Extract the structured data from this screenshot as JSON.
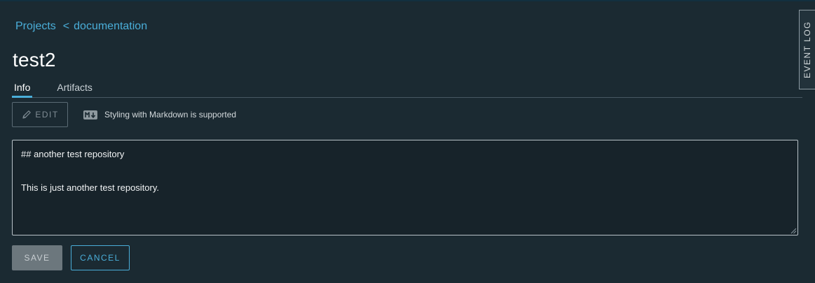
{
  "breadcrumb": {
    "parent": "Projects",
    "separator": "<",
    "current": "documentation"
  },
  "page": {
    "title": "test2"
  },
  "tabs": [
    {
      "label": "Info",
      "active": true
    },
    {
      "label": "Artifacts",
      "active": false
    }
  ],
  "toolbar": {
    "edit_label": "EDIT",
    "edit_icon": "pencil-icon",
    "markdown_icon": "markdown-icon",
    "markdown_hint": "Styling with Markdown is supported"
  },
  "editor": {
    "line1": "## another test repository",
    "line2": "This is just another test repository."
  },
  "actions": {
    "save_label": "SAVE",
    "cancel_label": "CANCEL"
  },
  "side_panel": {
    "event_log_label": "EVENT LOG"
  },
  "colors": {
    "background": "#1b2a32",
    "accent": "#4aaed9",
    "disabled_button": "#6c777d"
  }
}
